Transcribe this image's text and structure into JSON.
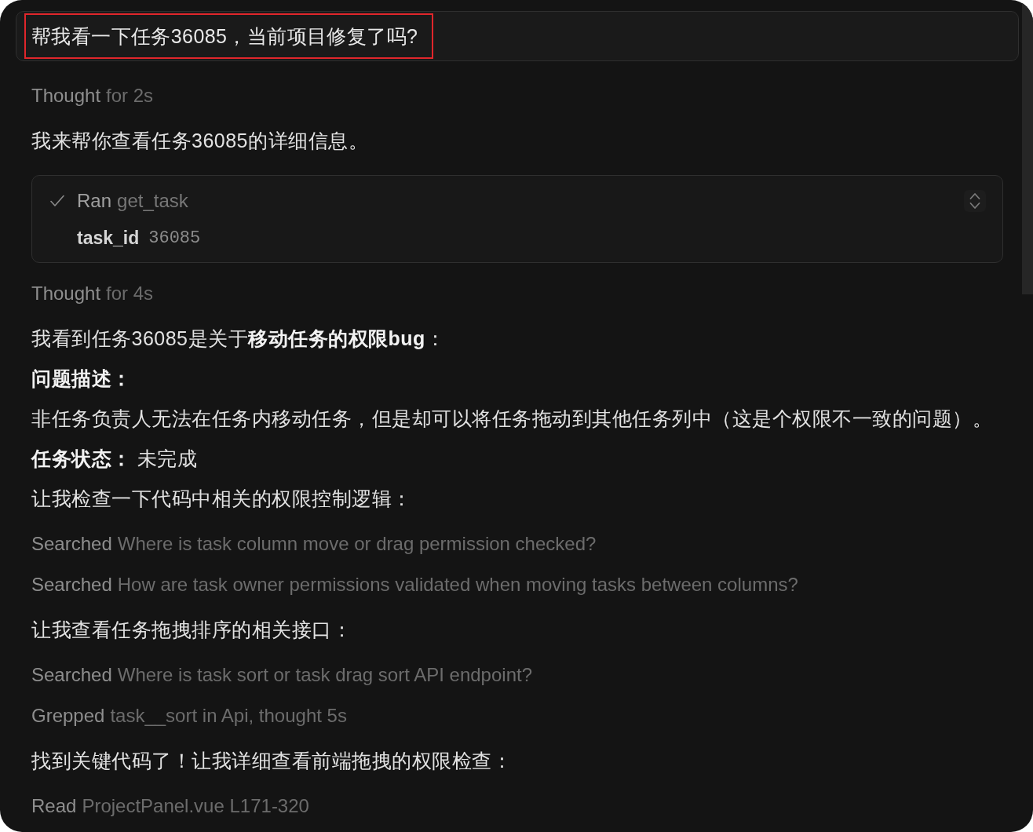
{
  "user_message": {
    "text": "帮我看一下任务36085，当前项目修复了吗?",
    "highlighted": true
  },
  "transcript": [
    {
      "kind": "activity",
      "verb": "Thought",
      "detail": "for 2s"
    },
    {
      "kind": "message",
      "paragraphs": [
        {
          "kind": "text",
          "text": "我来帮你查看任务36085的详细信息。"
        }
      ]
    },
    {
      "kind": "tool_call",
      "completed": true,
      "verb": "Ran",
      "name": "get_task",
      "params": [
        {
          "key": "task_id",
          "value": "36085"
        }
      ]
    },
    {
      "kind": "activity",
      "verb": "Thought",
      "detail": "for 4s"
    },
    {
      "kind": "message",
      "paragraphs": [
        {
          "kind": "text",
          "text": "我看到任务36085是关于**移动任务的权限bug**："
        },
        {
          "kind": "heading",
          "text": "问题描述："
        },
        {
          "kind": "text",
          "text": "非任务负责人无法在任务内移动任务，但是却可以将任务拖动到其他任务列中（这是个权限不一致的问题）。"
        },
        {
          "kind": "text",
          "text": "**任务状态：** 未完成"
        },
        {
          "kind": "text",
          "text": "让我检查一下代码中相关的权限控制逻辑："
        }
      ]
    },
    {
      "kind": "activity",
      "verb": "Searched",
      "detail": "Where is task column move or drag permission checked?"
    },
    {
      "kind": "activity",
      "verb": "Searched",
      "detail": "How are task owner permissions validated when moving tasks between columns?"
    },
    {
      "kind": "message",
      "paragraphs": [
        {
          "kind": "text",
          "text": "让我查看任务拖拽排序的相关接口："
        }
      ]
    },
    {
      "kind": "activity",
      "verb": "Searched",
      "detail": "Where is task sort or task drag sort API endpoint?"
    },
    {
      "kind": "activity",
      "verb": "Grepped",
      "detail": "task__sort in Api, thought 5s"
    },
    {
      "kind": "message",
      "paragraphs": [
        {
          "kind": "text",
          "text": "找到关键代码了！让我详细查看前端拖拽的权限检查："
        }
      ]
    },
    {
      "kind": "activity",
      "verb": "Read",
      "detail": "ProjectPanel.vue L171-320"
    }
  ]
}
